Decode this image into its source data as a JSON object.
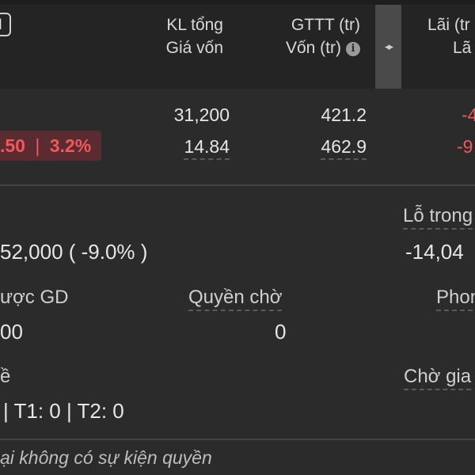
{
  "header": {
    "left_button_glyph": "l",
    "col1_line1": "KL tổng",
    "col1_line2": "Giá vốn",
    "col2_line1": "GTTT (tr)",
    "col2_line2": "Vốn (tr)",
    "col3_line1": "Lãi (tr",
    "col3_line2": "Lã",
    "scroll_glyph": "◂▸"
  },
  "row": {
    "change_value": ".50",
    "change_sep": "|",
    "change_pct": "3.2%",
    "kl_tong": "31,200",
    "gia_von": "14.84",
    "gttt": "421.2",
    "von": "462.9",
    "lai_1": "-4",
    "lai_2": "-9"
  },
  "summary": {
    "lo_trong_label": "Lỗ trong",
    "change_text": "52,000 ( -9.0% )",
    "lo_trong_value": "-14,04",
    "duoc_gd_label": "ược GD",
    "duoc_gd_value": "00",
    "quyen_cho_label": "Quyền chờ",
    "quyen_cho_value": "0",
    "phong_label": "Phon",
    "ve_label": "ề",
    "t_values": "| T1: 0 | T2: 0",
    "cho_giao_label": "Chờ gia",
    "note": "ại không có sự kiện quyền"
  },
  "colors": {
    "background": "#2b2b2b",
    "header_bg": "#242424",
    "negative": "#f1575b",
    "badge_bg": "#5a2c31"
  }
}
